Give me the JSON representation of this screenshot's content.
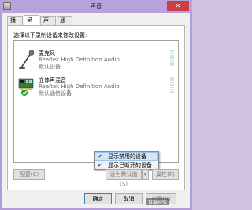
{
  "window": {
    "title": "声音",
    "close_glyph": "✕"
  },
  "tabs": [
    {
      "label": "播放",
      "active": false
    },
    {
      "label": "录制",
      "active": true
    },
    {
      "label": "声音",
      "active": false
    },
    {
      "label": "通信",
      "active": false
    }
  ],
  "panel": {
    "instruction": "选择以下录制设备来修改设置:"
  },
  "devices": [
    {
      "name": "麦克风",
      "driver": "Realtek High Definition Audio",
      "status": "默认设备",
      "icon": "microphone-icon"
    },
    {
      "name": "立体声混音",
      "driver": "Realtek High Definition Audio",
      "status": "默认通信设备",
      "icon": "sound-card-icon"
    }
  ],
  "context_menu": {
    "items": [
      {
        "label": "显示禁用的设备",
        "checked": true
      },
      {
        "label": "显示已断开的设备",
        "checked": true
      }
    ],
    "check_glyph": "✔"
  },
  "list_buttons": {
    "configure": "配置(C)",
    "set_default": "设为默认值(S)",
    "dropdown_glyph": "▾",
    "properties": "属性(P)"
  },
  "dialog_buttons": {
    "ok": "确定",
    "cancel": "取消",
    "apply": "应用(A)"
  },
  "watermark": "百度经验",
  "colors": {
    "accent": "#b49cd6",
    "close": "#c84040",
    "check_badge": "#2e9e3a"
  }
}
